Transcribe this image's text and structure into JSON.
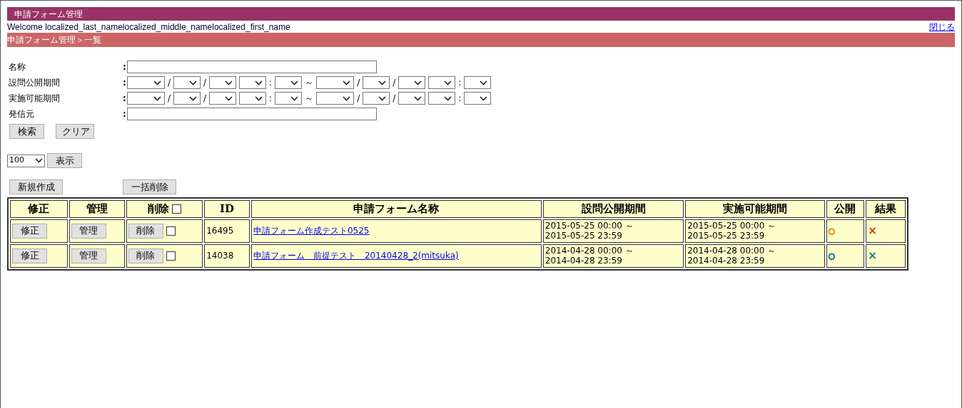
{
  "header": {
    "title": "申請フォーム管理"
  },
  "welcome": {
    "text": "Welcome localized_last_namelocalized_middle_namelocalized_first_name",
    "close_link": "閉じる"
  },
  "breadcrumb": "申請フォーム管理＞一覧",
  "search_form": {
    "rows": [
      {
        "kind": "text",
        "label": "名称",
        "colon": ":"
      },
      {
        "kind": "range",
        "label": "設問公開期間",
        "colon": ":",
        "parts": [
          {
            "kind": "wide_select"
          },
          {
            "kind": "sep",
            "text": "/"
          },
          {
            "kind": "narrow_select"
          },
          {
            "kind": "sep",
            "text": "/"
          },
          {
            "kind": "narrow_select"
          },
          {
            "kind": "narrow_select"
          },
          {
            "kind": "sep",
            "text": ":"
          },
          {
            "kind": "narrow_select"
          },
          {
            "kind": "sep",
            "text": "～"
          },
          {
            "kind": "wide_select"
          },
          {
            "kind": "sep",
            "text": "/"
          },
          {
            "kind": "narrow_select"
          },
          {
            "kind": "sep",
            "text": "/"
          },
          {
            "kind": "narrow_select"
          },
          {
            "kind": "narrow_select"
          },
          {
            "kind": "sep",
            "text": ":"
          },
          {
            "kind": "narrow_select"
          }
        ]
      },
      {
        "kind": "range",
        "label": "実施可能期間",
        "colon": ":",
        "parts": [
          {
            "kind": "wide_select"
          },
          {
            "kind": "sep",
            "text": "/"
          },
          {
            "kind": "narrow_select"
          },
          {
            "kind": "sep",
            "text": "/"
          },
          {
            "kind": "narrow_select"
          },
          {
            "kind": "narrow_select"
          },
          {
            "kind": "sep",
            "text": ":"
          },
          {
            "kind": "narrow_select"
          },
          {
            "kind": "sep",
            "text": "～"
          },
          {
            "kind": "wide_select"
          },
          {
            "kind": "sep",
            "text": "/"
          },
          {
            "kind": "narrow_select"
          },
          {
            "kind": "sep",
            "text": "/"
          },
          {
            "kind": "narrow_select"
          },
          {
            "kind": "narrow_select"
          },
          {
            "kind": "sep",
            "text": ":"
          },
          {
            "kind": "narrow_select"
          }
        ]
      },
      {
        "kind": "text",
        "label": "発信元",
        "colon": ":"
      }
    ],
    "buttons": [
      "検索",
      "クリア"
    ]
  },
  "page_size": {
    "value": "100",
    "button": "表示"
  },
  "actions": {
    "create": "新規作成",
    "bulk_delete": "一括削除"
  },
  "table": {
    "columns": [
      "修正",
      "管理",
      "削除",
      "ID",
      "申請フォーム名称",
      "設問公開期間",
      "実施可能期間",
      "公開",
      "結果"
    ],
    "select_all_checked": false,
    "rows": [
      {
        "edit": "修正",
        "manage": "管理",
        "delete": "削除",
        "checked": false,
        "id": "16495",
        "name": "申請フォーム作成テスト0525",
        "question_period": [
          "2015-05-25 00:00 ～",
          "2015-05-25 23:59"
        ],
        "available_period": [
          "2015-05-25 00:00 ～",
          "2015-05-25 23:59"
        ],
        "public": {
          "text": "○",
          "color": "#cc9900"
        },
        "result": {
          "text": "×",
          "color": "#cc3300"
        }
      },
      {
        "edit": "修正",
        "manage": "管理",
        "delete": "削除",
        "checked": false,
        "id": "14038",
        "name": "申請フォーム　前提テスト　20140428_2(mitsuka)",
        "question_period": [
          "2014-04-28 00:00 ～",
          "2014-04-28 23:59"
        ],
        "available_period": [
          "2014-04-28 00:00 ～",
          "2014-04-28 23:59"
        ],
        "public": {
          "text": "○",
          "color": "#008080"
        },
        "result": {
          "text": "×",
          "color": "#008080"
        }
      }
    ]
  }
}
